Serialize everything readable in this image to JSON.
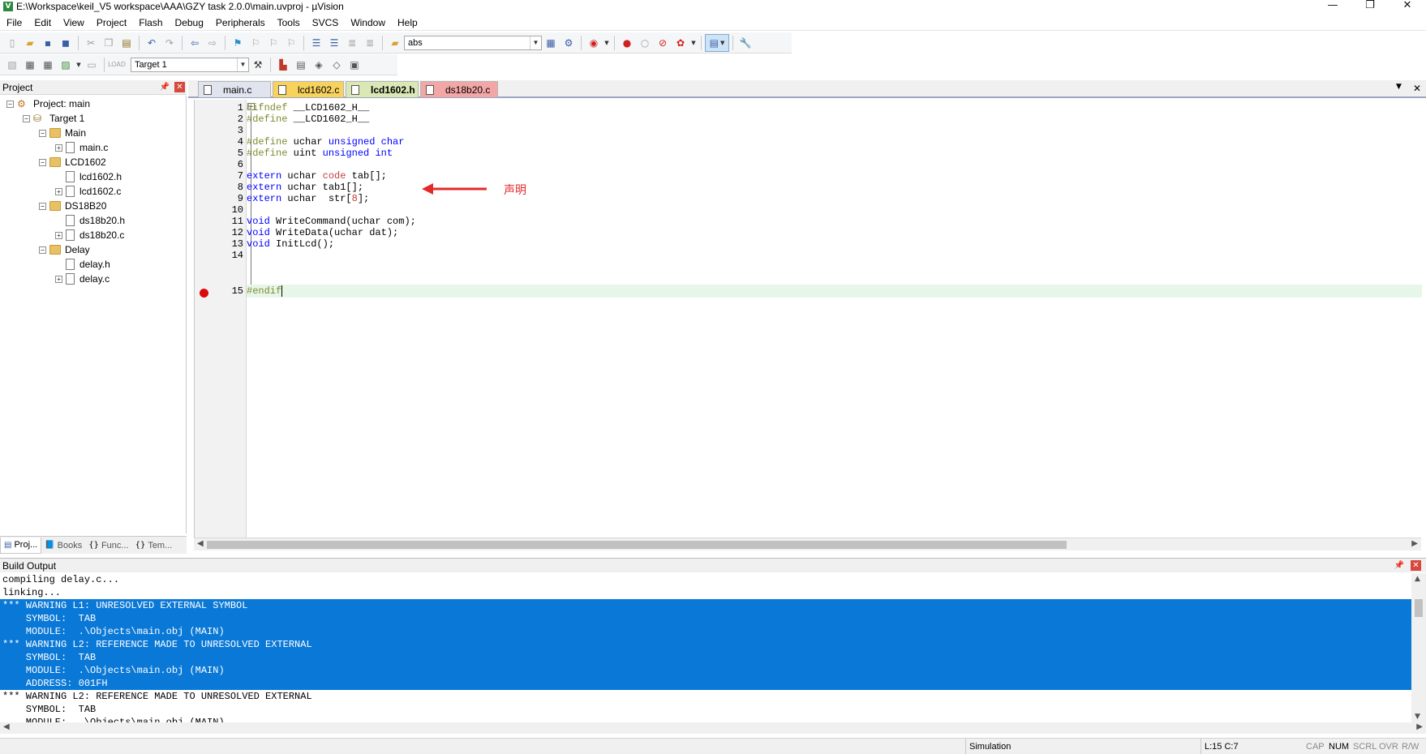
{
  "window": {
    "title": "E:\\Workspace\\keil_V5 workspace\\AAA\\GZY task 2.0.0\\main.uvproj - µVision",
    "minimize": "—",
    "restore": "❐",
    "close": "✕"
  },
  "menu": [
    "File",
    "Edit",
    "View",
    "Project",
    "Flash",
    "Debug",
    "Peripherals",
    "Tools",
    "SVCS",
    "Window",
    "Help"
  ],
  "toolbar": {
    "find_combo_value": "abs",
    "target_combo_value": "Target 1"
  },
  "project_panel": {
    "title": "Project",
    "tree": {
      "root": "Project: main",
      "target": "Target 1",
      "groups": [
        {
          "name": "Main",
          "files": [
            "main.c"
          ]
        },
        {
          "name": "LCD1602",
          "files": [
            "lcd1602.h",
            "lcd1602.c"
          ]
        },
        {
          "name": "DS18B20",
          "files": [
            "ds18b20.h",
            "ds18b20.c"
          ]
        },
        {
          "name": "Delay",
          "files": [
            "delay.h",
            "delay.c"
          ]
        }
      ]
    },
    "tabs": [
      "Proj...",
      "Books",
      "Func...",
      "Tem..."
    ]
  },
  "editor": {
    "tabs": [
      "main.c",
      "lcd1602.c",
      "lcd1602.h",
      "ds18b20.c"
    ],
    "active_tab": "lcd1602.h",
    "line_numbers": [
      "1",
      "2",
      "3",
      "4",
      "5",
      "6",
      "7",
      "8",
      "9",
      "10",
      "11",
      "12",
      "13",
      "14",
      "15"
    ],
    "lines": [
      "#ifndef __LCD1602_H__",
      "#define __LCD1602_H__",
      "",
      "#define uchar unsigned char",
      "#define uint unsigned int",
      "",
      "extern uchar code tab[];",
      "extern uchar tab1[];",
      "extern uchar  str[8];",
      "",
      "void WriteCommand(uchar com);",
      "void WriteData(uchar dat);",
      "void InitLcd();",
      "",
      "#endif"
    ],
    "annotation_text": "声明",
    "annotation_color": "#e22a2a"
  },
  "build_output": {
    "title": "Build Output",
    "lines": [
      {
        "text": "compiling delay.c...",
        "selected": false
      },
      {
        "text": "linking...",
        "selected": false
      },
      {
        "text": "*** WARNING L1: UNRESOLVED EXTERNAL SYMBOL",
        "selected": true
      },
      {
        "text": "    SYMBOL:  TAB",
        "selected": true
      },
      {
        "text": "    MODULE:  .\\Objects\\main.obj (MAIN)",
        "selected": true
      },
      {
        "text": "*** WARNING L2: REFERENCE MADE TO UNRESOLVED EXTERNAL",
        "selected": true
      },
      {
        "text": "    SYMBOL:  TAB",
        "selected": true
      },
      {
        "text": "    MODULE:  .\\Objects\\main.obj (MAIN)",
        "selected": true
      },
      {
        "text": "    ADDRESS: 001FH",
        "selected": true
      },
      {
        "text": "*** WARNING L2: REFERENCE MADE TO UNRESOLVED EXTERNAL",
        "selected": false
      },
      {
        "text": "    SYMBOL:  TAB",
        "selected": false
      },
      {
        "text": "    MODULE:  .\\Objects\\main.obj (MAIN)",
        "selected": false
      }
    ],
    "selection_color": "#0a78d7"
  },
  "status": {
    "mode": "Simulation",
    "position": "L:15 C:7",
    "indicators": [
      {
        "label": "CAP",
        "on": false
      },
      {
        "label": "NUM",
        "on": true
      },
      {
        "label": "SCRL",
        "on": false
      },
      {
        "label": "OVR",
        "on": false
      },
      {
        "label": "R/W",
        "on": false
      }
    ]
  }
}
